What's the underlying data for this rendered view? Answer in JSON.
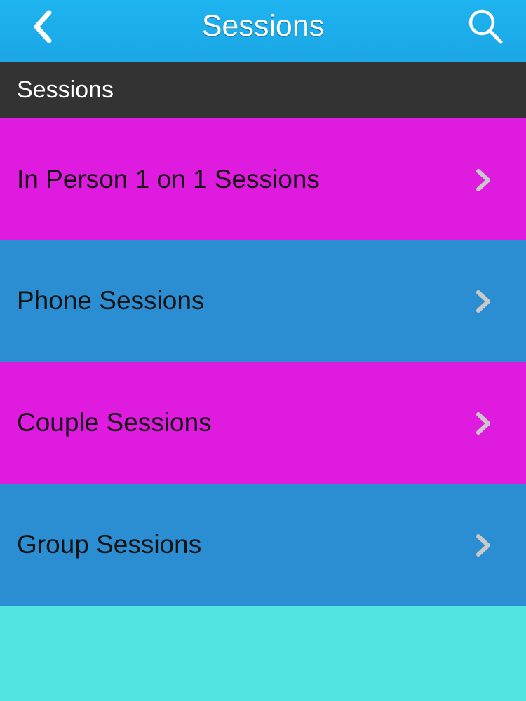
{
  "navbar": {
    "title": "Sessions",
    "back_icon": "chevron-left-icon",
    "search_icon": "search-icon"
  },
  "section": {
    "header": "Sessions"
  },
  "list": {
    "items": [
      {
        "label": "In Person 1 on 1 Sessions",
        "color": "#e01be0"
      },
      {
        "label": "Phone Sessions",
        "color": "#2b8dd2"
      },
      {
        "label": "Couple Sessions",
        "color": "#e01be0"
      },
      {
        "label": "Group Sessions",
        "color": "#2b8dd2"
      }
    ],
    "chevron_icon": "chevron-right-icon"
  },
  "colors": {
    "navbar": "#1ca6e6",
    "header_bar": "#333333",
    "background": "#52e4e0"
  }
}
